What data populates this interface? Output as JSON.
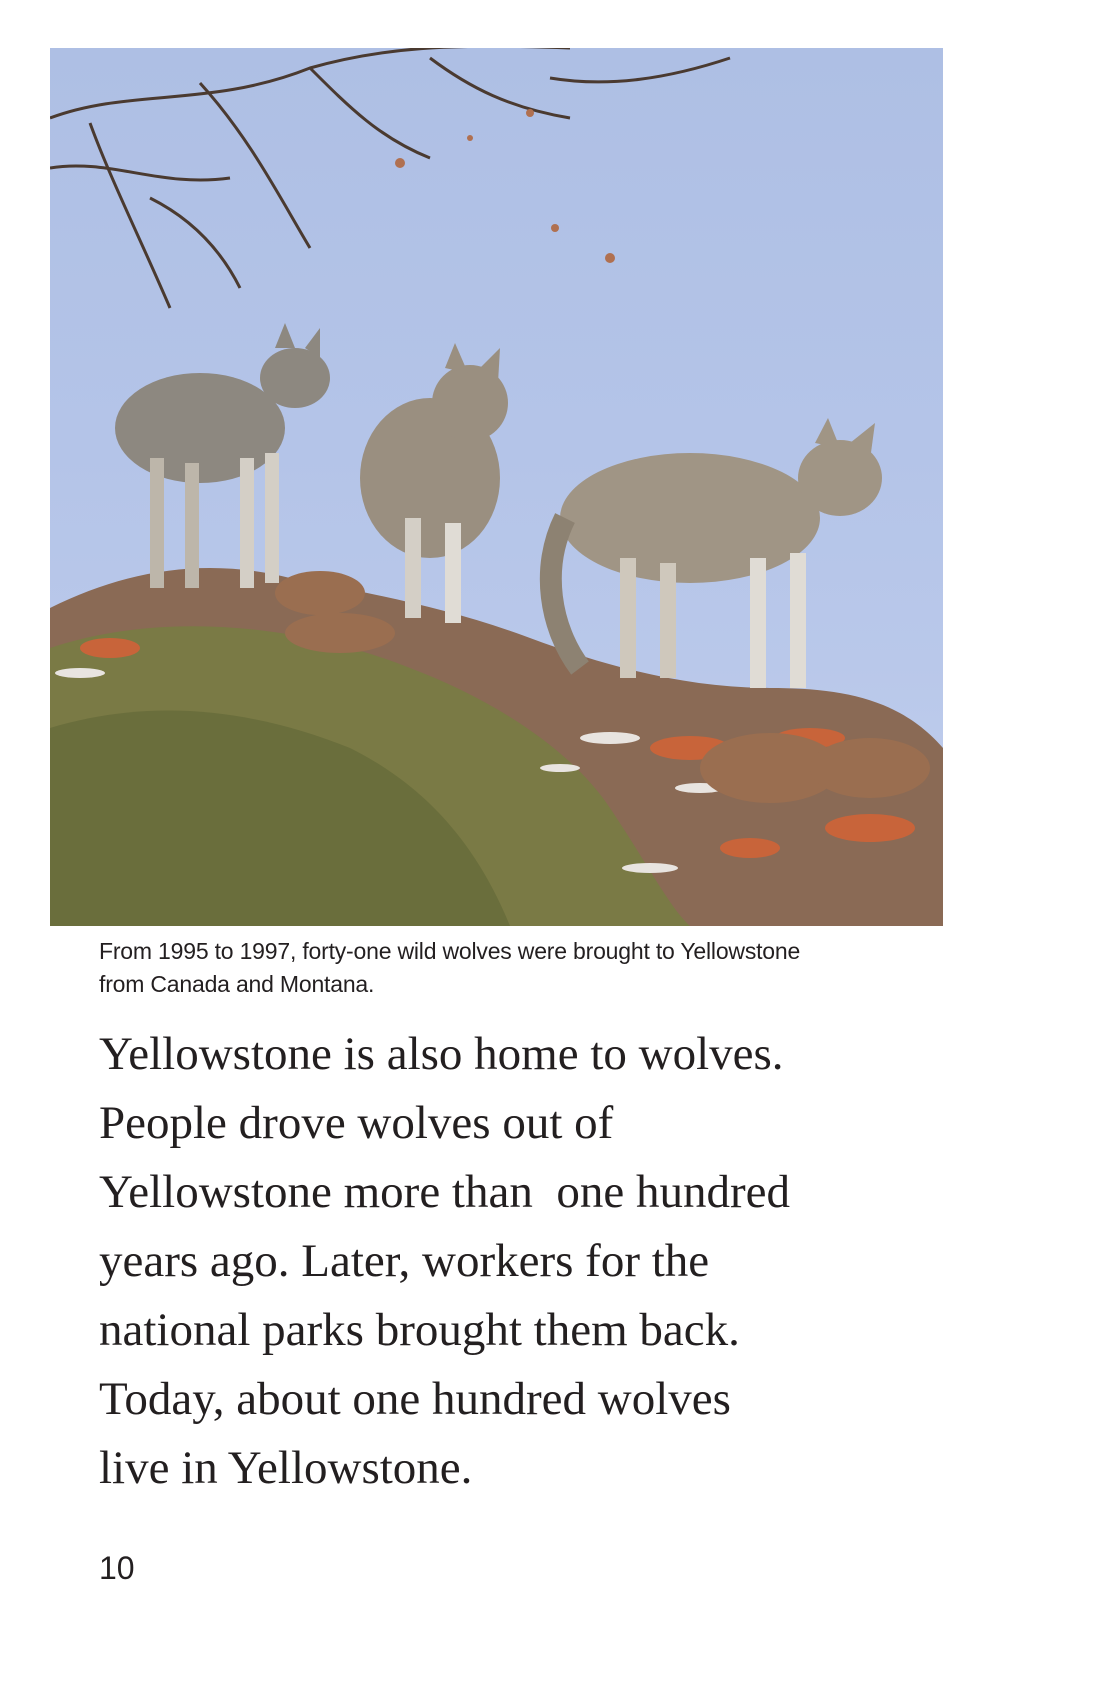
{
  "caption": {
    "line1": "From 1995 to 1997, forty-one wild wolves were brought to Yellowstone",
    "line2": "from Canada and Montana."
  },
  "body": {
    "lines": [
      "Yellowstone is also home to wolves.",
      "People drove wolves out of",
      "Yellowstone more than  one hundred",
      "years ago. Later, workers for the",
      "national parks brought them back.",
      "Today, about one hundred wolves",
      "live in Yellowstone."
    ]
  },
  "page_number": "10",
  "colors": {
    "sky": "#b4c4e8",
    "text": "#231f20",
    "rock": "#8a6a55",
    "lichen": "#c8643a",
    "shrub": "#7a7a45"
  }
}
